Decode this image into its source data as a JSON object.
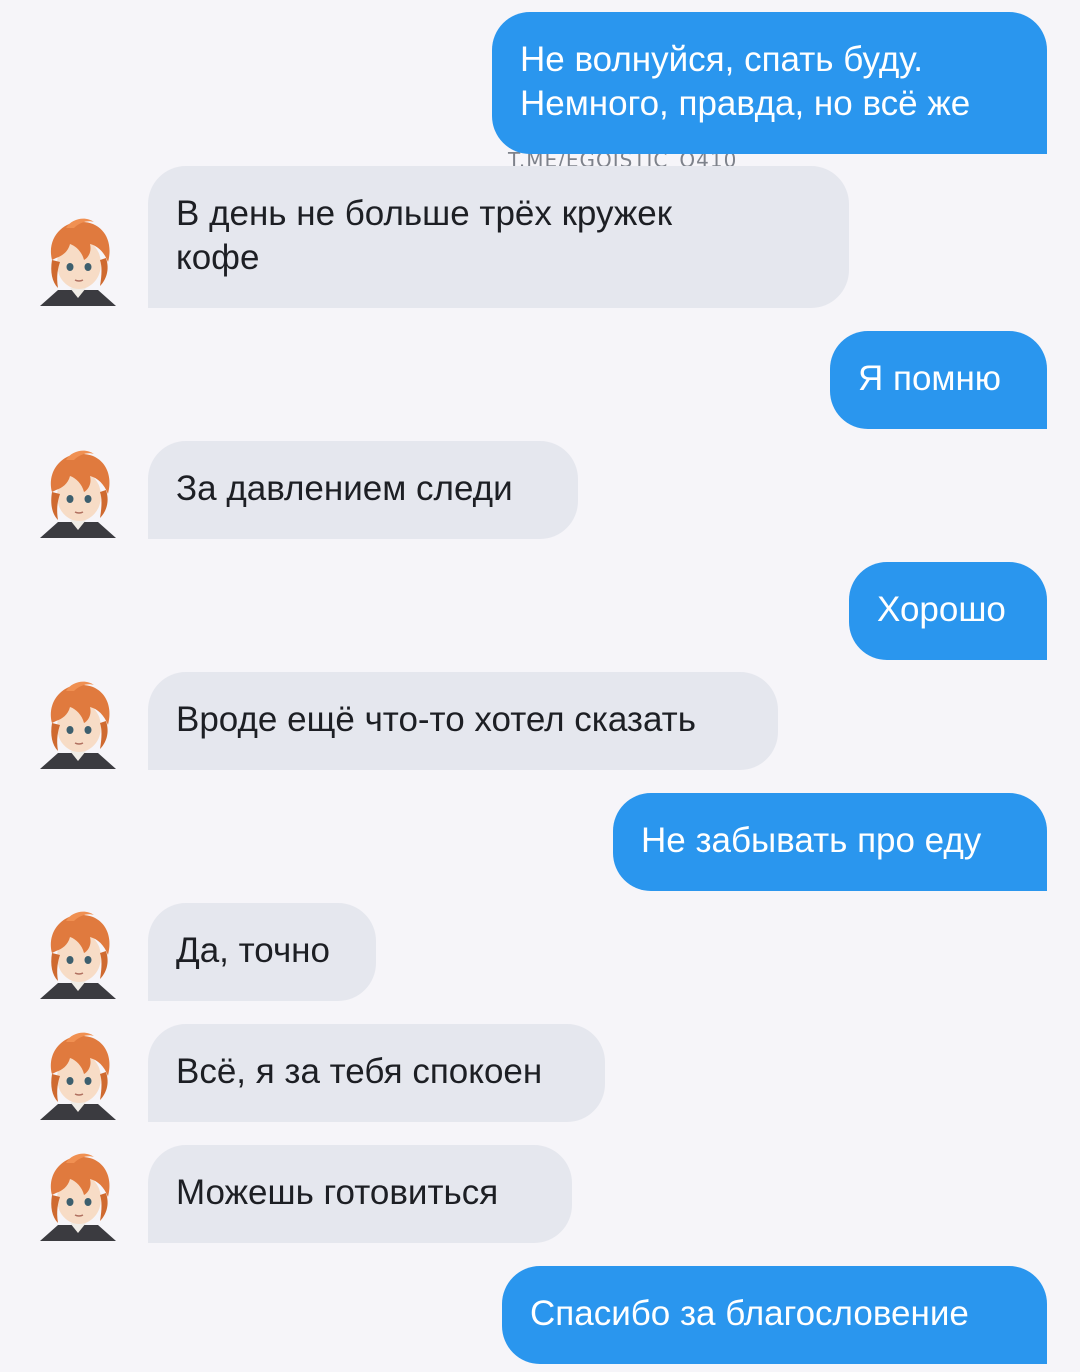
{
  "watermark": "T.ME/EGOISTIC_O410",
  "messages": [
    {
      "side": "out",
      "line1": "Не волнуйся, спать буду.",
      "line2": "Немного, правда, но всё же"
    },
    {
      "side": "in",
      "line1": "В день не больше трёх кружек",
      "line2": "кофе"
    },
    {
      "side": "out",
      "text": "Я помню"
    },
    {
      "side": "in",
      "text": "За давлением следи"
    },
    {
      "side": "out",
      "text": "Хорошо"
    },
    {
      "side": "in",
      "text": "Вроде ещё что-то хотел сказать"
    },
    {
      "side": "out",
      "text": "Не забывать про еду"
    },
    {
      "side": "in",
      "text": "Да, точно"
    },
    {
      "side": "in",
      "text": "Всё, я за тебя спокоен"
    },
    {
      "side": "in",
      "text": "Можешь готовиться"
    },
    {
      "side": "out",
      "text": "Спасибо за благословение"
    }
  ],
  "colors": {
    "background": "#f6f5f9",
    "outgoing_bubble": "#2a96ee",
    "incoming_bubble": "#e5e7ee",
    "avatar_hair": "#e07a3e"
  },
  "avatar_icon": "anime-character-avatar-icon"
}
